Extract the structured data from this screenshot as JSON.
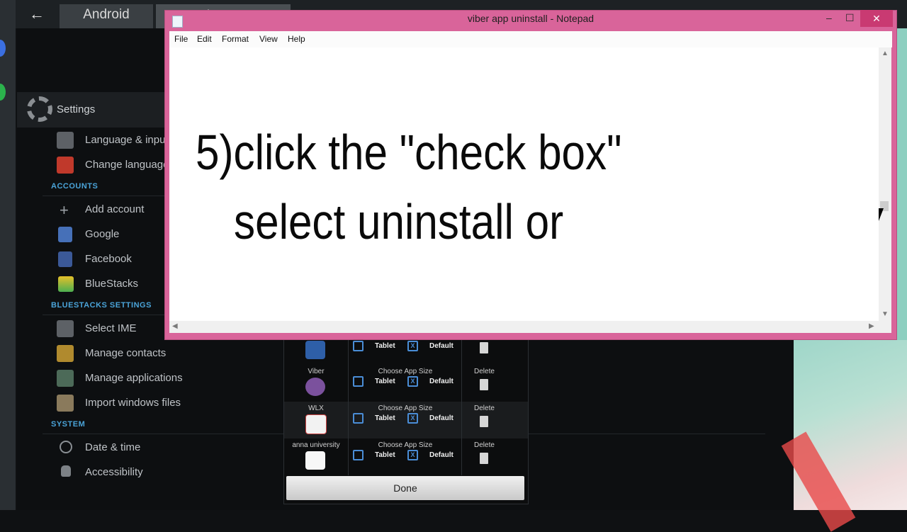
{
  "top_bar": {
    "back_glyph": "←",
    "tab_android": "Android",
    "tab_settings": "Settings"
  },
  "settings": {
    "title": "Settings",
    "rows": [
      {
        "label": "Language & input",
        "icon": "keyboard-icon"
      },
      {
        "label": "Change language",
        "icon": "flag-icon"
      }
    ],
    "section_accounts": "ACCOUNTS",
    "accounts": [
      {
        "label": "Add account",
        "icon": "plus-icon"
      },
      {
        "label": "Google",
        "icon": "google-icon"
      },
      {
        "label": "Facebook",
        "icon": "facebook-icon"
      },
      {
        "label": "BlueStacks",
        "icon": "bluestacks-icon"
      }
    ],
    "section_bluestacks": "BLUESTACKS SETTINGS",
    "bluestacks": [
      {
        "label": "Select IME",
        "icon": "keyboard-icon"
      },
      {
        "label": "Manage contacts",
        "icon": "contacts-icon"
      },
      {
        "label": "Manage applications",
        "icon": "apps-icon"
      },
      {
        "label": "Import windows files",
        "icon": "folder-icon"
      }
    ],
    "section_system": "SYSTEM",
    "system": [
      {
        "label": "Date & time",
        "icon": "clock-icon"
      },
      {
        "label": "Accessibility",
        "icon": "hand-icon"
      }
    ]
  },
  "dialog": {
    "rows": [
      {
        "name": "",
        "choose": "",
        "tablet": "Tablet",
        "default": "Default",
        "delete": ""
      },
      {
        "name": "Viber",
        "choose": "Choose App Size",
        "tablet": "Tablet",
        "default": "Default",
        "delete": "Delete"
      },
      {
        "name": "WLX",
        "choose": "Choose App Size",
        "tablet": "Tablet",
        "default": "Default",
        "delete": "Delete"
      },
      {
        "name": "anna university",
        "choose": "Choose App Size",
        "tablet": "Tablet",
        "default": "Default",
        "delete": "Delete"
      }
    ],
    "default_mark": "X",
    "done_label": "Done"
  },
  "notepad": {
    "title": "viber app uninstall - Notepad",
    "controls": {
      "minimize": "–",
      "maximize": "☐",
      "close": "✕"
    },
    "menu": [
      "File",
      "Edit",
      "Format",
      "View",
      "Help"
    ],
    "content_line1": "5)click the \"check box\"",
    "content_line2": "select uninstall or",
    "colors": {
      "frame": "#d9649a",
      "close": "#c93a72"
    }
  }
}
